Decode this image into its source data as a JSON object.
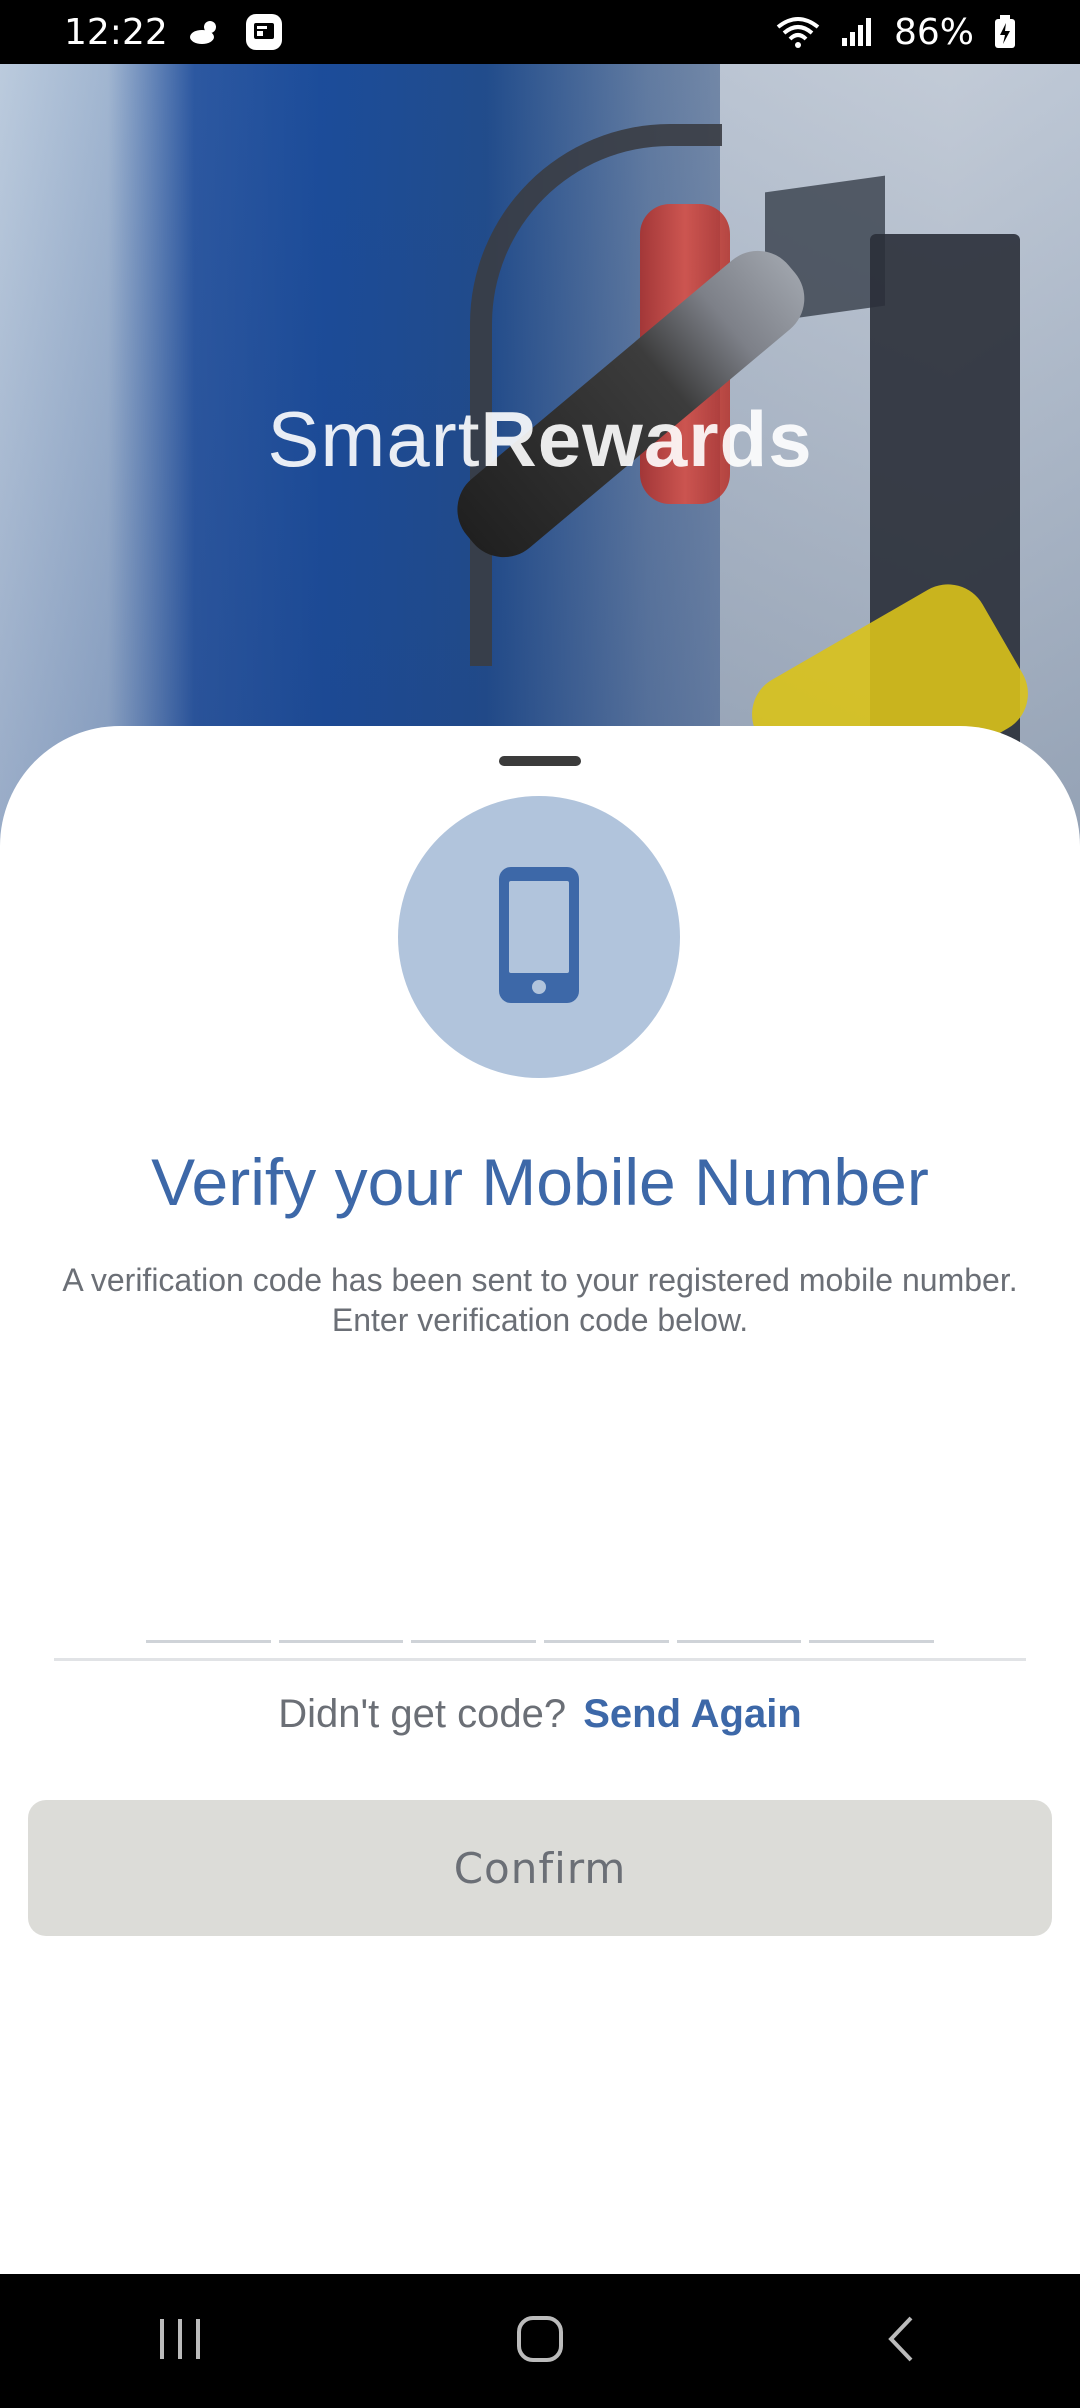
{
  "status_bar": {
    "time": "12:22",
    "battery": "86%",
    "icons": [
      "weather-icon",
      "notification-icon",
      "wifi-icon",
      "signal-icon",
      "battery-icon"
    ]
  },
  "hero": {
    "brand_light": "Smart",
    "brand_bold": "Rewards"
  },
  "sheet": {
    "title": "Verify your Mobile Number",
    "subtitle_line1": "A verification code has been sent to your registered mobile number.",
    "subtitle_line2": "Enter verification code below.",
    "code_digits": [
      "",
      "",
      "",
      "",
      "",
      ""
    ],
    "resend_prompt": "Didn't get code?",
    "resend_link": "Send Again",
    "confirm_label": "Confirm"
  },
  "colors": {
    "accent": "#3d68a8",
    "circle": "#b1c4dc",
    "button_disabled": "#dcdcd8",
    "text_muted": "#6b6f76"
  },
  "nav": {
    "icons": [
      "recent-apps-icon",
      "home-icon",
      "back-icon"
    ]
  }
}
